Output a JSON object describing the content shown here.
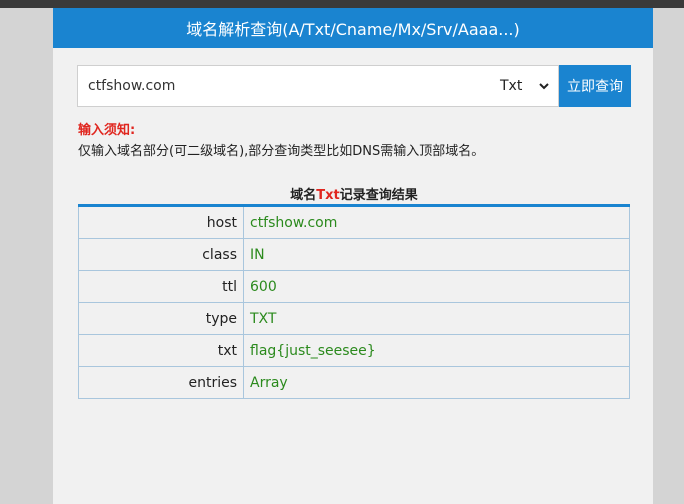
{
  "header": {
    "title": "域名解析查询(A/Txt/Cname/Mx/Srv/Aaaa...)"
  },
  "search": {
    "domain_value": "ctfshow.com",
    "type_selected": "Txt",
    "button_label": "立即查询"
  },
  "notice": {
    "title": "输入须知:",
    "text": "仅输入域名部分(可二级域名),部分查询类型比如DNS需输入顶部域名。"
  },
  "result": {
    "title_prefix": "域名",
    "title_type": "Txt",
    "title_suffix": "记录查询结果",
    "rows": [
      {
        "key": "host",
        "value": "ctfshow.com"
      },
      {
        "key": "class",
        "value": "IN"
      },
      {
        "key": "ttl",
        "value": "600"
      },
      {
        "key": "type",
        "value": "TXT"
      },
      {
        "key": "txt",
        "value": "flag{just_seesee}"
      },
      {
        "key": "entries",
        "value": "Array"
      }
    ]
  },
  "colors": {
    "brand_blue": "#1a84d0",
    "alert_red": "#e0261f",
    "value_green": "#2b8a1d"
  },
  "icons": {
    "select_arrow": "chevron-down-icon"
  }
}
